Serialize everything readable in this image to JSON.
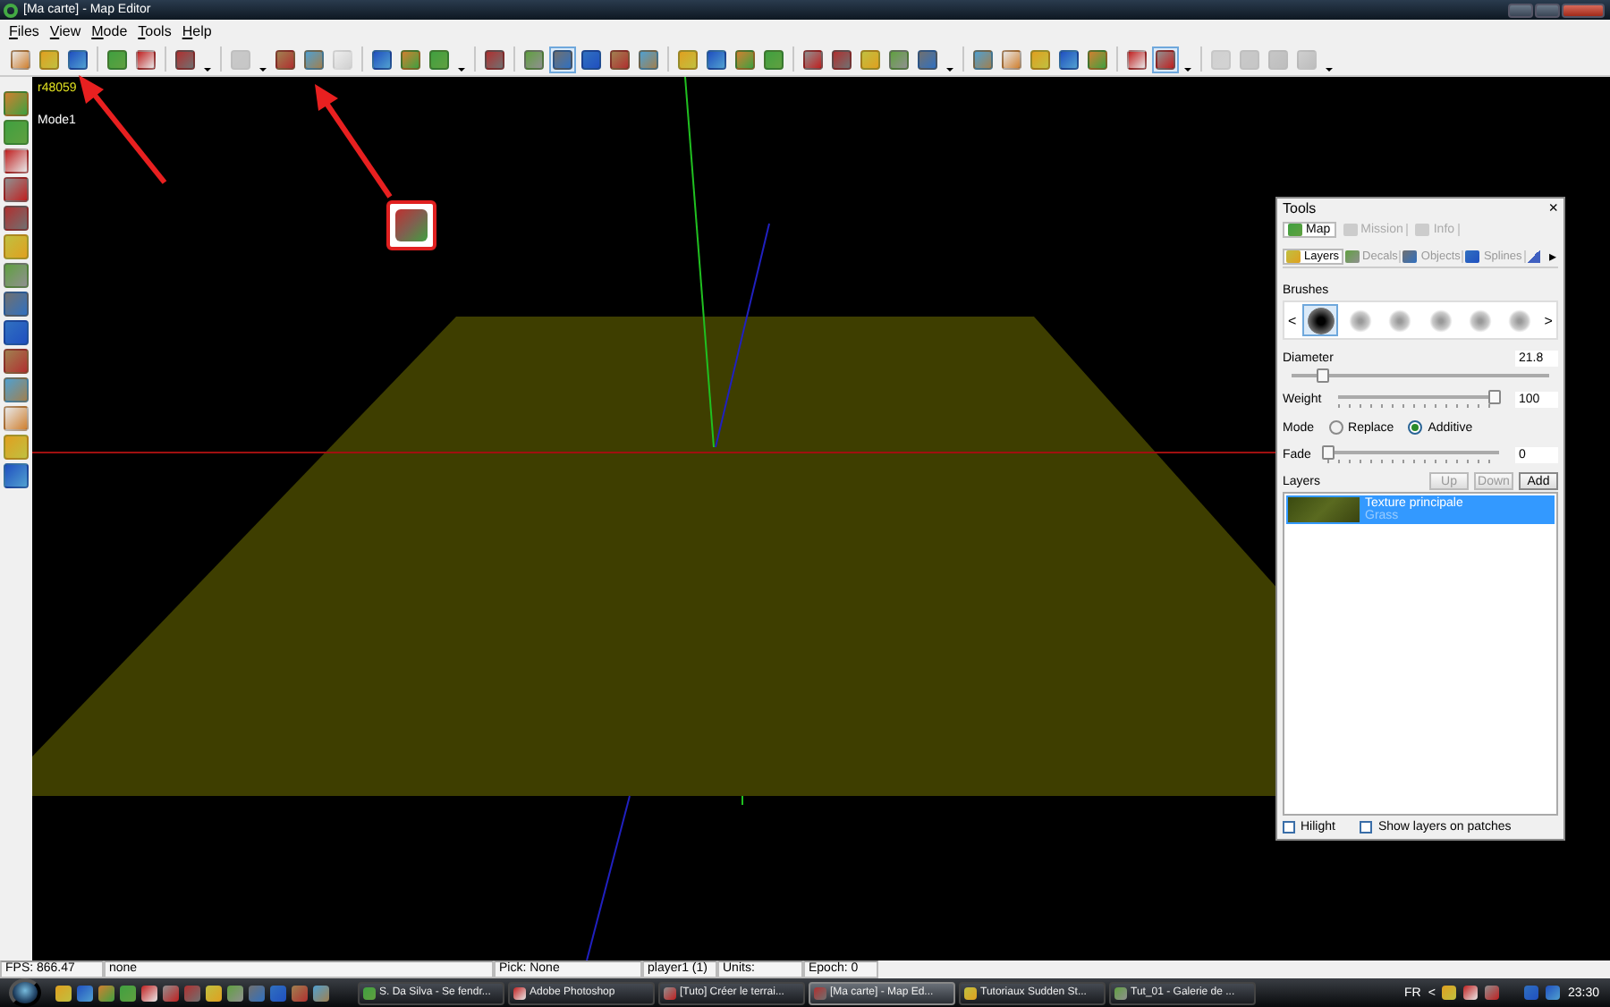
{
  "window": {
    "title": "[Ma carte] - Map Editor"
  },
  "menu": [
    "Files",
    "View",
    "Mode",
    "Tools",
    "Help"
  ],
  "toolbar": [
    {
      "kind": "button",
      "selected": false,
      "disabled": false
    },
    {
      "kind": "button",
      "selected": false,
      "disabled": false
    },
    {
      "kind": "button",
      "selected": false,
      "disabled": false
    },
    {
      "kind": "separator"
    },
    {
      "kind": "button",
      "selected": false,
      "disabled": false
    },
    {
      "kind": "button",
      "selected": false,
      "disabled": false
    },
    {
      "kind": "separator"
    },
    {
      "kind": "button",
      "selected": false,
      "disabled": false
    },
    {
      "kind": "dropdown"
    },
    {
      "kind": "separator"
    },
    {
      "kind": "button",
      "selected": false,
      "disabled": true
    },
    {
      "kind": "dropdown"
    },
    {
      "kind": "button",
      "selected": false,
      "disabled": false
    },
    {
      "kind": "button",
      "selected": false,
      "disabled": false
    },
    {
      "kind": "button",
      "selected": false,
      "disabled": true
    },
    {
      "kind": "separator"
    },
    {
      "kind": "button",
      "selected": false,
      "disabled": false
    },
    {
      "kind": "button",
      "selected": false,
      "disabled": false
    },
    {
      "kind": "button",
      "selected": false,
      "disabled": false
    },
    {
      "kind": "dropdown"
    },
    {
      "kind": "separator"
    },
    {
      "kind": "button",
      "selected": false,
      "disabled": false
    },
    {
      "kind": "separator"
    },
    {
      "kind": "button",
      "selected": false,
      "disabled": false
    },
    {
      "kind": "button",
      "selected": true,
      "disabled": false
    },
    {
      "kind": "button",
      "selected": false,
      "disabled": false
    },
    {
      "kind": "button",
      "selected": false,
      "disabled": false
    },
    {
      "kind": "button",
      "selected": false,
      "disabled": false
    },
    {
      "kind": "separator"
    },
    {
      "kind": "button",
      "selected": false,
      "disabled": false
    },
    {
      "kind": "button",
      "selected": false,
      "disabled": false
    },
    {
      "kind": "button",
      "selected": false,
      "disabled": false
    },
    {
      "kind": "button",
      "selected": false,
      "disabled": false
    },
    {
      "kind": "separator"
    },
    {
      "kind": "button",
      "selected": false,
      "disabled": false
    },
    {
      "kind": "button",
      "selected": false,
      "disabled": false
    },
    {
      "kind": "button",
      "selected": false,
      "disabled": false
    },
    {
      "kind": "button",
      "selected": false,
      "disabled": false
    },
    {
      "kind": "button",
      "selected": false,
      "disabled": false
    },
    {
      "kind": "dropdown"
    },
    {
      "kind": "separator"
    },
    {
      "kind": "button",
      "selected": false,
      "disabled": false
    },
    {
      "kind": "button",
      "selected": false,
      "disabled": false
    },
    {
      "kind": "button",
      "selected": false,
      "disabled": false
    },
    {
      "kind": "button",
      "selected": false,
      "disabled": false
    },
    {
      "kind": "button",
      "selected": false,
      "disabled": false
    },
    {
      "kind": "separator"
    },
    {
      "kind": "button",
      "selected": false,
      "disabled": false
    },
    {
      "kind": "button",
      "selected": true,
      "disabled": false
    },
    {
      "kind": "dropdown"
    },
    {
      "kind": "separator"
    },
    {
      "kind": "button",
      "selected": false,
      "disabled": true
    },
    {
      "kind": "button",
      "selected": false,
      "disabled": true
    },
    {
      "kind": "button",
      "selected": false,
      "disabled": true
    },
    {
      "kind": "button",
      "selected": false,
      "disabled": true
    },
    {
      "kind": "dropdown"
    }
  ],
  "viewport": {
    "build": "r48059",
    "mode": "Mode1"
  },
  "tools_panel": {
    "title": "Tools",
    "close": "×",
    "top_tabs": [
      {
        "label": "Map",
        "selected": true,
        "disabled": false
      },
      {
        "label": "Mission",
        "selected": false,
        "disabled": true
      },
      {
        "label": "Info",
        "selected": false,
        "disabled": true
      }
    ],
    "sub_tabs": [
      {
        "label": "Layers",
        "selected": true
      },
      {
        "label": "Decals",
        "selected": false
      },
      {
        "label": "Objects",
        "selected": false
      },
      {
        "label": "Splines",
        "selected": false
      }
    ],
    "tab_scroll": "▸",
    "brushes": {
      "label": "Brushes",
      "prev": "<",
      "next": ">",
      "items": [
        {
          "selected": true
        },
        {
          "selected": false
        },
        {
          "selected": false
        },
        {
          "selected": false
        },
        {
          "selected": false
        },
        {
          "selected": false
        }
      ]
    },
    "diameter": {
      "label": "Diameter",
      "value": "21.8",
      "level": 0.12
    },
    "weight": {
      "label": "Weight",
      "value": "100",
      "level": 0.97
    },
    "mode": {
      "label": "Mode",
      "options": [
        {
          "label": "Replace",
          "selected": false
        },
        {
          "label": "Additive",
          "selected": true
        }
      ]
    },
    "fade": {
      "label": "Fade",
      "value": "0",
      "level": 0
    },
    "layers": {
      "label": "Layers",
      "buttons": [
        {
          "label": "Up",
          "disabled": true
        },
        {
          "label": "Down",
          "disabled": true
        },
        {
          "label": "Add",
          "disabled": false
        }
      ],
      "items": [
        {
          "name": "Texture principale",
          "type": "Grass",
          "selected": true
        }
      ]
    },
    "checkboxes": [
      {
        "label": "Hilight",
        "checked": false
      },
      {
        "label": "Show layers on patches",
        "checked": false
      }
    ]
  },
  "status_bar": [
    "FPS: 866.47",
    "none",
    "Pick: None",
    "player1 (1)",
    "Units:",
    "Epoch: 0"
  ],
  "taskbar": {
    "tasks": [
      {
        "label": "S. Da Silva - Se fendr...",
        "selected": false
      },
      {
        "label": "Adobe Photoshop",
        "selected": false
      },
      {
        "label": "[Tuto] Créer le terrai...",
        "selected": false
      },
      {
        "label": "[Ma carte] - Map Ed...",
        "selected": true
      },
      {
        "label": "Tutoriaux Sudden St...",
        "selected": false
      },
      {
        "label": "Tut_01 - Galerie de ...",
        "selected": false
      }
    ],
    "language": "FR",
    "tray_arrow": "<",
    "clock": "23:30"
  }
}
